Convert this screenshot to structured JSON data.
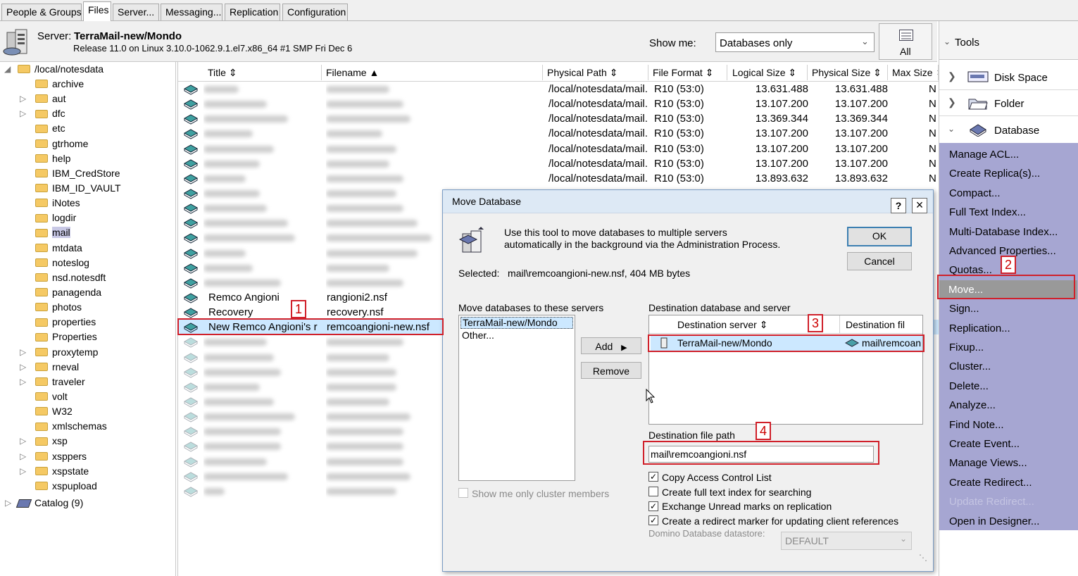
{
  "tabs": [
    "People & Groups",
    "Files",
    "Server...",
    "Messaging...",
    "Replication",
    "Configuration"
  ],
  "header": {
    "server_label": "Server:",
    "server_name": "TerraMail-new/Mondo",
    "release": "Release 11.0 on Linux 3.10.0-1062.9.1.el7.x86_64 #1 SMP Fri Dec 6",
    "show_me_label": "Show me:",
    "show_me_value": "Databases only",
    "all_label": "All"
  },
  "tree": {
    "root": "/local/notesdata",
    "items": [
      "archive",
      "aut",
      "dfc",
      "etc",
      "gtrhome",
      "help",
      "IBM_CredStore",
      "IBM_ID_VAULT",
      "iNotes",
      "logdir",
      "mail",
      "mtdata",
      "noteslog",
      "nsd.notesdft",
      "panagenda",
      "photos",
      "properties",
      "Properties",
      "proxytemp",
      "rneval",
      "traveler",
      "volt",
      "W32",
      "xmlschemas",
      "xsp",
      "xsppers",
      "xspstate",
      "xspupload"
    ],
    "catalog": "Catalog (9)"
  },
  "grid": {
    "columns": [
      "Title",
      "Filename",
      "Physical Path",
      "File Format",
      "Logical Size",
      "Physical Size",
      "Max Size"
    ],
    "rows": [
      {
        "path": "/local/notesdata/mail.",
        "format": "R10 (53:0)",
        "logical": "13.631.488",
        "physical": "13.631.488",
        "max": "N"
      },
      {
        "path": "/local/notesdata/mail.",
        "format": "R10 (53:0)",
        "logical": "13.107.200",
        "physical": "13.107.200",
        "max": "N"
      },
      {
        "path": "/local/notesdata/mail.",
        "format": "R10 (53:0)",
        "logical": "13.369.344",
        "physical": "13.369.344",
        "max": "N"
      },
      {
        "path": "/local/notesdata/mail.",
        "format": "R10 (53:0)",
        "logical": "13.107.200",
        "physical": "13.107.200",
        "max": "N"
      },
      {
        "path": "/local/notesdata/mail.",
        "format": "R10 (53:0)",
        "logical": "13.107.200",
        "physical": "13.107.200",
        "max": "N"
      },
      {
        "path": "/local/notesdata/mail.",
        "format": "R10 (53:0)",
        "logical": "13.107.200",
        "physical": "13.107.200",
        "max": "N"
      },
      {
        "path": "/local/notesdata/mail.",
        "format": "R10 (53:0)",
        "logical": "13.893.632",
        "physical": "13.893.632",
        "max": "N"
      }
    ],
    "named_rows": [
      {
        "title": "Remco Angioni",
        "filename": "rangioni2.nsf"
      },
      {
        "title": "Recovery",
        "filename": "recovery.nsf"
      },
      {
        "title": "New Remco Angioni's r",
        "filename": "remcoangioni-new.nsf"
      }
    ]
  },
  "dialog": {
    "title": "Move Database",
    "help": "?",
    "close": "×",
    "description_line1": "Use this tool to move databases to multiple servers",
    "description_line2": "automatically in the background via the Administration Process.",
    "selected": "Selected:   mail\\remcoangioni-new.nsf, 404 MB bytes",
    "ok": "OK",
    "cancel": "Cancel",
    "servers_label": "Move databases to these servers",
    "servers": [
      "TerraMail-new/Mondo",
      "Other..."
    ],
    "add": "Add",
    "remove": "Remove",
    "cluster_only": "Show me only cluster members",
    "dest_label": "Destination database and server",
    "dest_col_server": "Destination server",
    "dest_col_file": "Destination fil",
    "dest_row_server": "TerraMail-new/Mondo",
    "dest_row_file": "mail\\remcoan",
    "path_label": "Destination file path",
    "path_value": "mail\\remcoangioni.nsf",
    "options": [
      {
        "label": "Copy Access Control List",
        "checked": true
      },
      {
        "label": "Create full text index for searching",
        "checked": false
      },
      {
        "label": "Exchange Unread marks on replication",
        "checked": true
      },
      {
        "label": "Create a redirect marker for updating client references",
        "checked": true
      }
    ],
    "datastore_label": "Domino Database datastore:",
    "datastore_value": "DEFAULT"
  },
  "tools": {
    "header": "Tools",
    "sections": [
      "Disk Space",
      "Folder",
      "Database"
    ],
    "actions": [
      "Manage ACL...",
      "Create Replica(s)...",
      "Compact...",
      "Full Text Index...",
      "Multi-Database Index...",
      "Advanced Properties...",
      "Quotas...",
      "Move...",
      "Sign...",
      "Replication...",
      "Fixup...",
      "Cluster...",
      "Delete...",
      "Analyze...",
      "Find Note...",
      "Create Event...",
      "Manage Views...",
      "Create Redirect...",
      "Update Redirect...",
      "Open in Designer..."
    ]
  },
  "annotations": [
    "1",
    "2",
    "3",
    "4"
  ],
  "colors": {
    "accent": "#d0202a",
    "tools_bg": "#a6a6d2",
    "selection": "#cce8ff"
  }
}
